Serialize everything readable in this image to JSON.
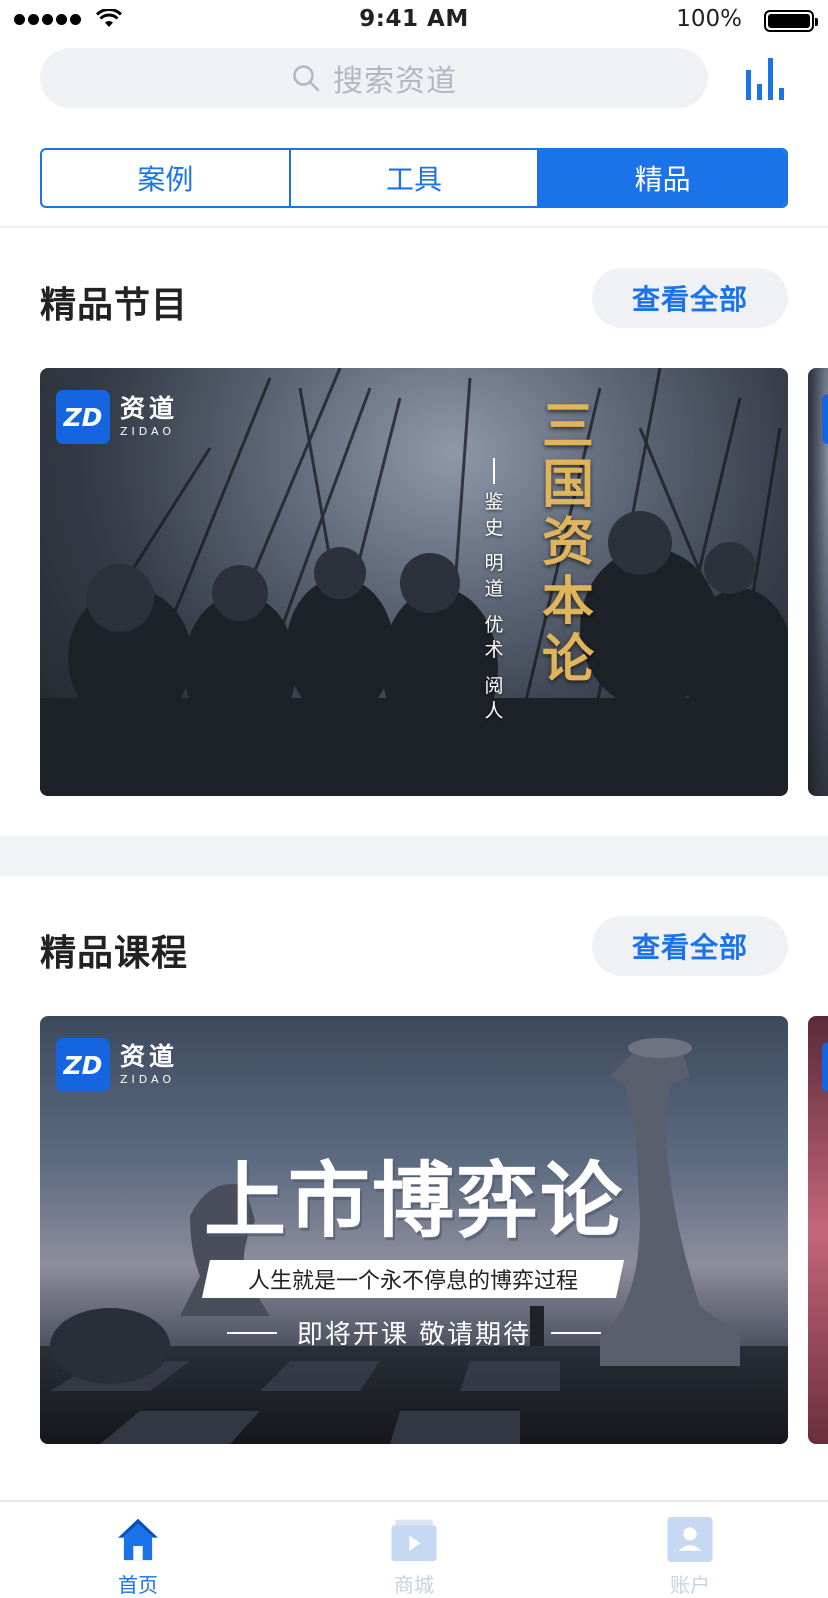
{
  "status_bar": {
    "time": "9:41 AM",
    "battery": "100%"
  },
  "search": {
    "placeholder": "搜索资道"
  },
  "segments": [
    {
      "label": "案例",
      "active": false
    },
    {
      "label": "工具",
      "active": false
    },
    {
      "label": "精品",
      "active": true
    }
  ],
  "programs": {
    "title": "精品节目",
    "more_label": "查看全部",
    "banner": {
      "brand_name": "资道",
      "brand_sub": "ZIDAO",
      "title_chars": [
        "三",
        "国",
        "资",
        "本",
        "论"
      ],
      "tagline_chars": [
        "鉴",
        "史",
        "明",
        "道",
        "优",
        "术",
        "阅",
        "人"
      ]
    }
  },
  "courses": {
    "title": "精品课程",
    "more_label": "查看全部",
    "banner": {
      "brand_name": "资道",
      "brand_sub": "ZIDAO",
      "title": "上市博弈论",
      "subtitle": "人生就是一个永不停息的博弈过程",
      "cta": "即将开课  敬请期待"
    }
  },
  "tab_bar": [
    {
      "label": "首页",
      "icon": "home-icon",
      "active": true
    },
    {
      "label": "商城",
      "icon": "store-icon",
      "active": false
    },
    {
      "label": "账户",
      "icon": "account-icon",
      "active": false
    }
  ],
  "colors": {
    "accent": "#1a73e8",
    "inactive": "#c7d2e4",
    "gold": "#e0b45a"
  }
}
